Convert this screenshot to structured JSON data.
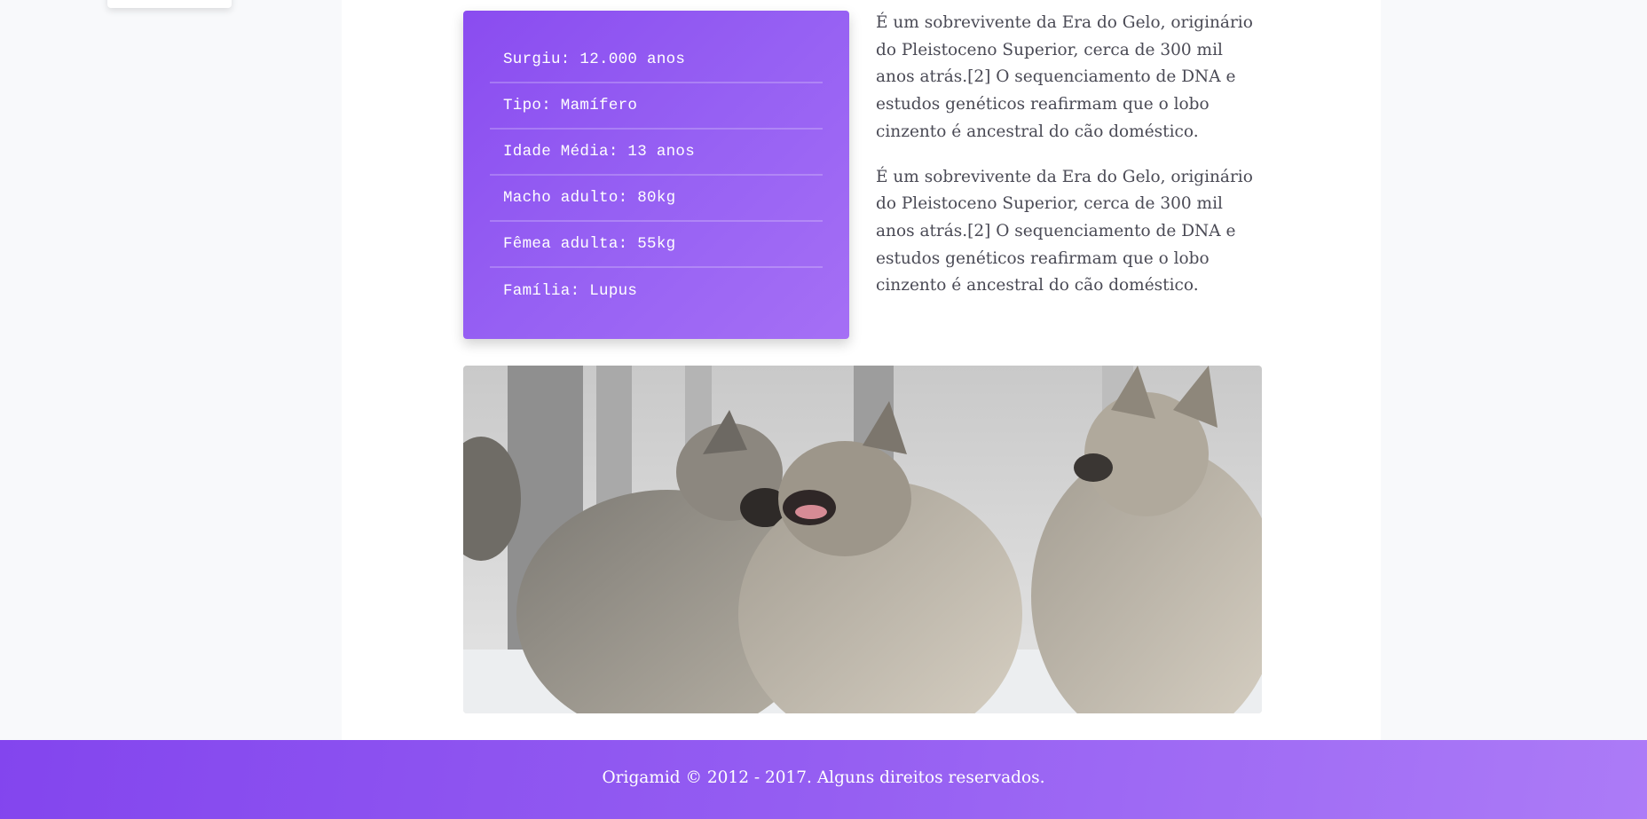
{
  "facts": [
    {
      "label": "Surgiu: 12.000 anos"
    },
    {
      "label": "Tipo: Mamífero"
    },
    {
      "label": "Idade Média: 13 anos"
    },
    {
      "label": "Macho adulto: 80kg"
    },
    {
      "label": "Fêmea adulta: 55kg"
    },
    {
      "label": "Família: Lupus"
    }
  ],
  "paragraphs": [
    "É um sobrevivente da Era do Gelo, originário do Pleistoceno Superior, cerca de 300 mil anos atrás.[2] O sequenciamento de DNA e estudos genéticos reafirmam que o lobo cinzento é ancestral do cão doméstico.",
    "É um sobrevivente da Era do Gelo, originário do Pleistoceno Superior, cerca de 300 mil anos atrás.[2] O sequenciamento de DNA e estudos genéticos reafirmam que o lobo cinzento é ancestral do cão doméstico."
  ],
  "footer": {
    "text": "Origamid © 2012 - 2017. Alguns direitos reservados."
  },
  "colors": {
    "accent": "#8a4cf0",
    "accent_light": "#a56ff5",
    "text": "#4a4a55",
    "page_bg": "#f8f9fb"
  }
}
